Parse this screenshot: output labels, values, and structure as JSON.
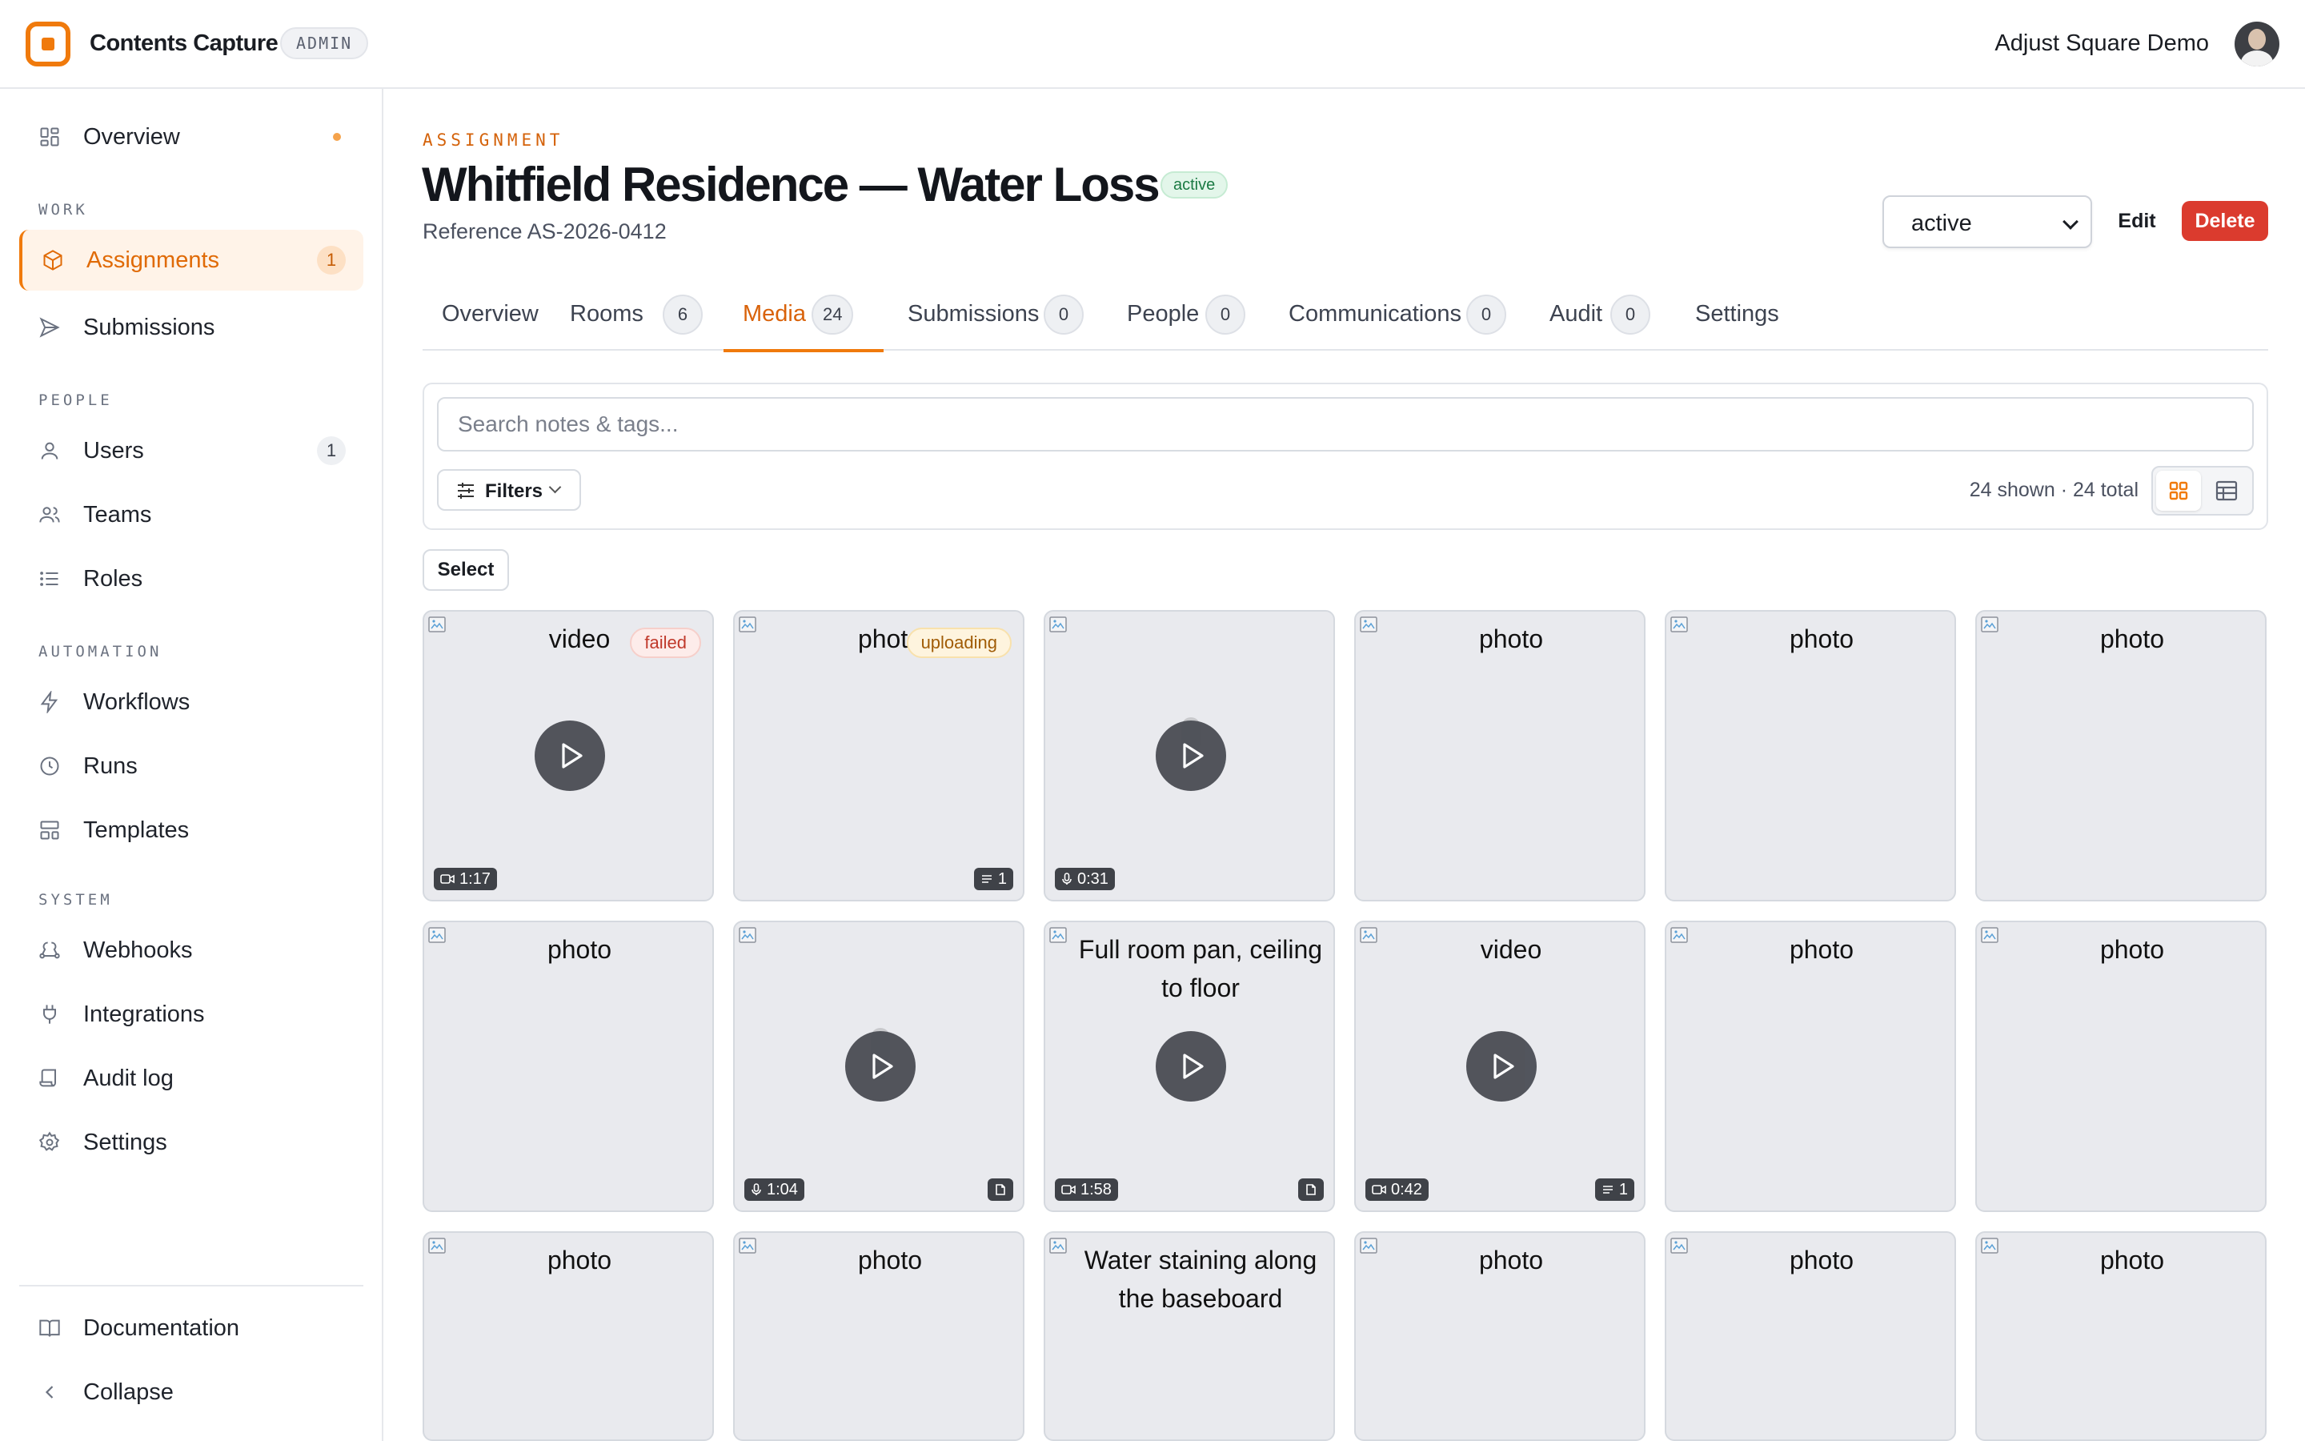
{
  "header": {
    "app_name": "Contents Capture",
    "role_badge": "ADMIN",
    "account_name": "Adjust Square Demo"
  },
  "sidebar": {
    "overview": "Overview",
    "sections": {
      "work": "WORK",
      "people": "PEOPLE",
      "automation": "AUTOMATION",
      "system": "SYSTEM"
    },
    "items": {
      "assignments": {
        "label": "Assignments",
        "count": "1"
      },
      "submissions": {
        "label": "Submissions"
      },
      "users": {
        "label": "Users",
        "count": "1"
      },
      "teams": {
        "label": "Teams"
      },
      "roles": {
        "label": "Roles"
      },
      "workflows": {
        "label": "Workflows"
      },
      "runs": {
        "label": "Runs"
      },
      "templates": {
        "label": "Templates"
      },
      "webhooks": {
        "label": "Webhooks"
      },
      "integrations": {
        "label": "Integrations"
      },
      "audit_log": {
        "label": "Audit log"
      },
      "settings": {
        "label": "Settings"
      }
    },
    "documentation": "Documentation",
    "collapse": "Collapse"
  },
  "page": {
    "eyebrow": "ASSIGNMENT",
    "title": "Whitfield Residence — Water Loss",
    "status_badge": "active",
    "reference": "Reference AS-2026-0412",
    "status_select_value": "active",
    "edit_label": "Edit",
    "delete_label": "Delete"
  },
  "tabs": [
    {
      "label": "Overview",
      "count": null
    },
    {
      "label": "Rooms",
      "count": "6"
    },
    {
      "label": "Media",
      "count": "24",
      "active": true
    },
    {
      "label": "Submissions",
      "count": "0"
    },
    {
      "label": "People",
      "count": "0"
    },
    {
      "label": "Communications",
      "count": "0"
    },
    {
      "label": "Audit",
      "count": "0"
    },
    {
      "label": "Settings",
      "count": null
    }
  ],
  "media": {
    "search_placeholder": "Search notes & tags...",
    "filters_label": "Filters",
    "counts_text": "24 shown · 24 total",
    "select_label": "Select",
    "tiles": [
      {
        "alt": "video",
        "status": "failed",
        "play": true,
        "left_chip": {
          "icon": "video",
          "text": "1:17"
        }
      },
      {
        "alt": "photo",
        "status": "uploading",
        "right_chip": {
          "icon": "notes",
          "text": "1"
        }
      },
      {
        "alt": "",
        "play": true,
        "left_chip": {
          "icon": "mic",
          "text": "0:31"
        }
      },
      {
        "alt": "photo"
      },
      {
        "alt": "photo"
      },
      {
        "alt": "photo"
      },
      {
        "alt": "photo"
      },
      {
        "alt": "",
        "play": true,
        "left_chip": {
          "icon": "mic",
          "text": "1:04"
        },
        "right_chip": {
          "icon": "doc",
          "text": ""
        }
      },
      {
        "alt": "Full room pan, ceiling to floor",
        "play": true,
        "left_chip": {
          "icon": "video",
          "text": "1:58"
        },
        "right_chip": {
          "icon": "doc",
          "text": ""
        }
      },
      {
        "alt": "video",
        "play": true,
        "left_chip": {
          "icon": "video",
          "text": "0:42"
        },
        "right_chip": {
          "icon": "notes",
          "text": "1"
        }
      },
      {
        "alt": "photo"
      },
      {
        "alt": "photo"
      },
      {
        "alt": "photo"
      },
      {
        "alt": "photo"
      },
      {
        "alt": "Water staining along the baseboard"
      },
      {
        "alt": "photo"
      },
      {
        "alt": "photo"
      },
      {
        "alt": "photo"
      }
    ]
  },
  "colors": {
    "accent": "#f07a0c",
    "danger": "#db3b2e",
    "success_bg": "#e3f6ea"
  }
}
